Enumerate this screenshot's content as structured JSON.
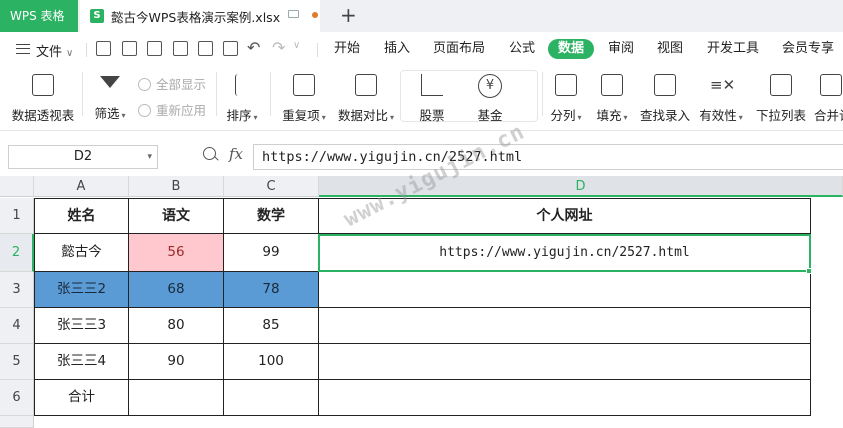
{
  "titlebar": {
    "app_name": "WPS 表格",
    "file_tab_label": "懿古今WPS表格演示案例.xlsx",
    "new_tab_symbol": "+"
  },
  "menubar": {
    "file_menu": "文件",
    "tabs": [
      "开始",
      "插入",
      "页面布局",
      "公式",
      "数据",
      "审阅",
      "视图",
      "开发工具",
      "会员专享"
    ],
    "active_tab": "数据"
  },
  "ribbon": {
    "pivot": "数据透视表",
    "filter": "筛选",
    "show_all": "全部显示",
    "reapply": "重新应用",
    "sort": "排序",
    "duplicates": "重复项",
    "compare": "数据对比",
    "stocks": "股票",
    "funds": "基金",
    "split": "分列",
    "fill": "填充",
    "lookup": "查找录入",
    "validation": "有效性",
    "dropdown": "下拉列表",
    "merge": "合并计"
  },
  "formulabar": {
    "name_box": "D2",
    "fx": "fx",
    "formula": "https://www.yigujin.cn/2527.html"
  },
  "sheet": {
    "columns": [
      "A",
      "B",
      "C",
      "D"
    ],
    "rows": [
      "1",
      "2",
      "3",
      "4",
      "5",
      "6"
    ],
    "header": [
      "姓名",
      "语文",
      "数学",
      "个人网址"
    ],
    "data": [
      [
        "懿古今",
        "56",
        "99",
        "https://www.yigujin.cn/2527.html"
      ],
      [
        "张三三2",
        "68",
        "78",
        ""
      ],
      [
        "张三三3",
        "80",
        "85",
        ""
      ],
      [
        "张三三4",
        "90",
        "100",
        ""
      ],
      [
        "合计",
        "",
        "",
        ""
      ]
    ],
    "selected_cell": "D2",
    "highlight_colors": {
      "pink": "#ffc7ce",
      "blue": "#5b9bd5",
      "accent": "#2bb262"
    }
  },
  "watermark": "www.yigujin.cn"
}
